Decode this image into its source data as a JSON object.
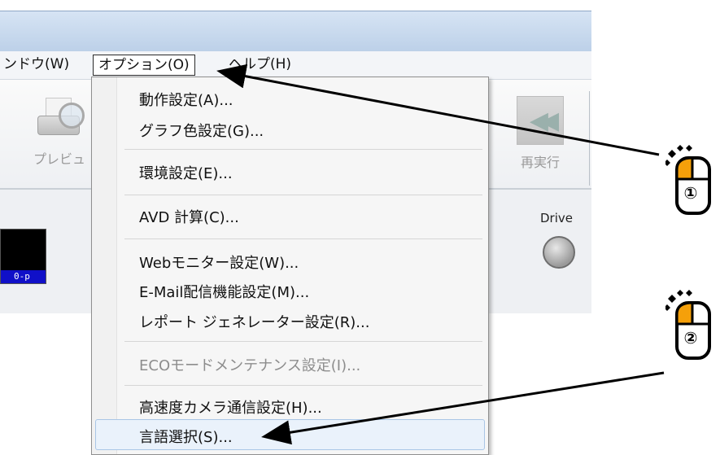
{
  "menubar": {
    "window": "ンドウ(W)",
    "options": "オプション(O)",
    "help": "ヘルプ(H)"
  },
  "toolbar": {
    "preview": "プレビュ",
    "rerun": "再実行"
  },
  "status": {
    "drive": "Drive",
    "display_label": "0-p"
  },
  "dropdown": {
    "items": [
      {
        "label": "動作設定(A)...",
        "enabled": true
      },
      {
        "label": "グラフ色設定(G)...",
        "enabled": true
      },
      {
        "label": "環境設定(E)...",
        "enabled": true
      },
      {
        "label": "AVD 計算(C)...",
        "enabled": true
      },
      {
        "label": "Webモニター設定(W)...",
        "enabled": true
      },
      {
        "label": "E-Mail配信機能設定(M)...",
        "enabled": true
      },
      {
        "label": "レポート ジェネレーター設定(R)...",
        "enabled": true
      },
      {
        "label": "ECOモードメンテナンス設定(I)...",
        "enabled": false
      },
      {
        "label": "高速度カメラ通信設定(H)...",
        "enabled": true
      },
      {
        "label": "言語選択(S)...",
        "enabled": true,
        "highlighted": true
      }
    ]
  },
  "callouts": {
    "step1": "①",
    "step2": "②"
  },
  "colors": {
    "mouse_button": "#f5a00a",
    "highlight": "#eaf2fb"
  }
}
